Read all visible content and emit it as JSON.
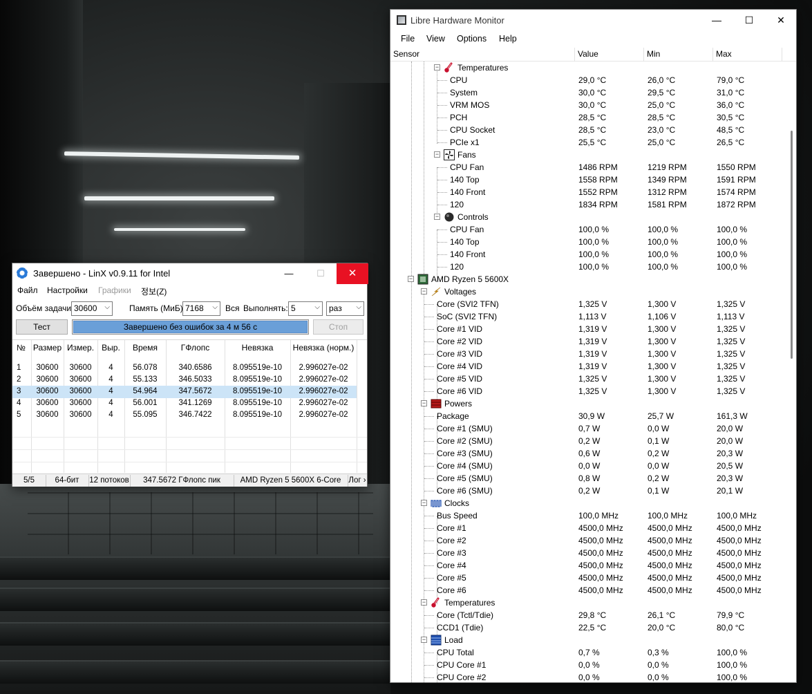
{
  "linx": {
    "title": "Завершено - LinX v0.9.11 for Intel",
    "window_controls": {
      "minimize": "—",
      "maximize": "☐",
      "close": "✕"
    },
    "menu": [
      "Файл",
      "Настройки",
      "Графики",
      "정보(Z)"
    ],
    "controls": {
      "task_size_label": "Объём задачи:",
      "task_size_value": "30600",
      "memory_label": "Память (МиБ):",
      "memory_value": "7168",
      "all_label": "Вся",
      "run_label": "Выполнять:",
      "run_value": "5",
      "unit_value": "раз"
    },
    "test_button": "Тест",
    "stop_button": "Стоп",
    "progress_text": "Завершено без ошибок за 4 м 56 с",
    "progress_value": 1.0,
    "columns": [
      "№",
      "Размер",
      "Измер.",
      "Выр.",
      "Время",
      "ГФлопс",
      "Невязка",
      "Невязка (норм.)"
    ],
    "rows": [
      [
        "1",
        "30600",
        "30600",
        "4",
        "56.078",
        "340.6586",
        "8.095519e-10",
        "2.996027e-02"
      ],
      [
        "2",
        "30600",
        "30600",
        "4",
        "55.133",
        "346.5033",
        "8.095519e-10",
        "2.996027e-02"
      ],
      [
        "3",
        "30600",
        "30600",
        "4",
        "54.964",
        "347.5672",
        "8.095519e-10",
        "2.996027e-02"
      ],
      [
        "4",
        "30600",
        "30600",
        "4",
        "56.001",
        "341.1269",
        "8.095519e-10",
        "2.996027e-02"
      ],
      [
        "5",
        "30600",
        "30600",
        "4",
        "55.095",
        "346.7422",
        "8.095519e-10",
        "2.996027e-02"
      ]
    ],
    "status": [
      "5/5",
      "64-бит",
      "12 потоков",
      "347.5672 ГФлопс пик",
      "AMD Ryzen 5 5600X 6-Core",
      "Лог ›"
    ]
  },
  "lhm": {
    "title": "Libre Hardware Monitor",
    "window_controls": {
      "minimize": "—",
      "maximize": "☐",
      "close": "✕"
    },
    "menu": [
      "File",
      "View",
      "Options",
      "Help"
    ],
    "columns": [
      "Sensor",
      "Value",
      "Min",
      "Max"
    ],
    "rows": [
      {
        "level": 2,
        "type": "group",
        "icon": "thermometer-icon",
        "label": "Temperatures"
      },
      {
        "level": 3,
        "label": "CPU",
        "value": "29,0 °C",
        "min": "26,0 °C",
        "max": "79,0 °C"
      },
      {
        "level": 3,
        "label": "System",
        "value": "30,0 °C",
        "min": "29,5 °C",
        "max": "31,0 °C"
      },
      {
        "level": 3,
        "label": "VRM MOS",
        "value": "30,0 °C",
        "min": "25,0 °C",
        "max": "36,0 °C"
      },
      {
        "level": 3,
        "label": "PCH",
        "value": "28,5 °C",
        "min": "28,5 °C",
        "max": "30,5 °C"
      },
      {
        "level": 3,
        "label": "CPU Socket",
        "value": "28,5 °C",
        "min": "23,0 °C",
        "max": "48,5 °C"
      },
      {
        "level": 3,
        "label": "PCIe x1",
        "value": "25,5 °C",
        "min": "25,0 °C",
        "max": "26,5 °C"
      },
      {
        "level": 2,
        "type": "group",
        "icon": "fan-icon",
        "label": "Fans"
      },
      {
        "level": 3,
        "label": "CPU Fan",
        "value": "1486 RPM",
        "min": "1219 RPM",
        "max": "1550 RPM"
      },
      {
        "level": 3,
        "label": "140 Top",
        "value": "1558 RPM",
        "min": "1349 RPM",
        "max": "1591 RPM"
      },
      {
        "level": 3,
        "label": "140 Front",
        "value": "1552 RPM",
        "min": "1312 RPM",
        "max": "1574 RPM"
      },
      {
        "level": 3,
        "label": "120",
        "value": "1834 RPM",
        "min": "1581 RPM",
        "max": "1872 RPM"
      },
      {
        "level": 2,
        "type": "group",
        "icon": "control-knob-icon",
        "label": "Controls"
      },
      {
        "level": 3,
        "label": "CPU Fan",
        "value": "100,0 %",
        "min": "100,0 %",
        "max": "100,0 %"
      },
      {
        "level": 3,
        "label": "140 Top",
        "value": "100,0 %",
        "min": "100,0 %",
        "max": "100,0 %"
      },
      {
        "level": 3,
        "label": "140 Front",
        "value": "100,0 %",
        "min": "100,0 %",
        "max": "100,0 %"
      },
      {
        "level": 3,
        "label": "120",
        "value": "100,0 %",
        "min": "100,0 %",
        "max": "100,0 %"
      },
      {
        "level": 0,
        "type": "group",
        "icon": "cpu-chip-icon",
        "label": "AMD Ryzen 5 5600X"
      },
      {
        "level": 1,
        "type": "group",
        "icon": "lightning-icon",
        "label": "Voltages"
      },
      {
        "level": 2,
        "label": "Core (SVI2 TFN)",
        "value": "1,325 V",
        "min": "1,300 V",
        "max": "1,325 V"
      },
      {
        "level": 2,
        "label": "SoC (SVI2 TFN)",
        "value": "1,113 V",
        "min": "1,106 V",
        "max": "1,113 V"
      },
      {
        "level": 2,
        "label": "Core #1 VID",
        "value": "1,319 V",
        "min": "1,300 V",
        "max": "1,325 V"
      },
      {
        "level": 2,
        "label": "Core #2 VID",
        "value": "1,319 V",
        "min": "1,300 V",
        "max": "1,325 V"
      },
      {
        "level": 2,
        "label": "Core #3 VID",
        "value": "1,319 V",
        "min": "1,300 V",
        "max": "1,325 V"
      },
      {
        "level": 2,
        "label": "Core #4 VID",
        "value": "1,319 V",
        "min": "1,300 V",
        "max": "1,325 V"
      },
      {
        "level": 2,
        "label": "Core #5 VID",
        "value": "1,325 V",
        "min": "1,300 V",
        "max": "1,325 V"
      },
      {
        "level": 2,
        "label": "Core #6 VID",
        "value": "1,325 V",
        "min": "1,300 V",
        "max": "1,325 V"
      },
      {
        "level": 1,
        "type": "group",
        "icon": "power-icon",
        "label": "Powers"
      },
      {
        "level": 2,
        "label": "Package",
        "value": "30,9 W",
        "min": "25,7 W",
        "max": "161,3 W"
      },
      {
        "level": 2,
        "label": "Core #1 (SMU)",
        "value": "0,7 W",
        "min": "0,0 W",
        "max": "20,0 W"
      },
      {
        "level": 2,
        "label": "Core #2 (SMU)",
        "value": "0,2 W",
        "min": "0,1 W",
        "max": "20,0 W"
      },
      {
        "level": 2,
        "label": "Core #3 (SMU)",
        "value": "0,6 W",
        "min": "0,2 W",
        "max": "20,3 W"
      },
      {
        "level": 2,
        "label": "Core #4 (SMU)",
        "value": "0,0 W",
        "min": "0,0 W",
        "max": "20,5 W"
      },
      {
        "level": 2,
        "label": "Core #5 (SMU)",
        "value": "0,8 W",
        "min": "0,2 W",
        "max": "20,3 W"
      },
      {
        "level": 2,
        "label": "Core #6 (SMU)",
        "value": "0,2 W",
        "min": "0,1 W",
        "max": "20,1 W"
      },
      {
        "level": 1,
        "type": "group",
        "icon": "clock-signal-icon",
        "label": "Clocks"
      },
      {
        "level": 2,
        "label": "Bus Speed",
        "value": "100,0 MHz",
        "min": "100,0 MHz",
        "max": "100,0 MHz"
      },
      {
        "level": 2,
        "label": "Core #1",
        "value": "4500,0 MHz",
        "min": "4500,0 MHz",
        "max": "4500,0 MHz"
      },
      {
        "level": 2,
        "label": "Core #2",
        "value": "4500,0 MHz",
        "min": "4500,0 MHz",
        "max": "4500,0 MHz"
      },
      {
        "level": 2,
        "label": "Core #3",
        "value": "4500,0 MHz",
        "min": "4500,0 MHz",
        "max": "4500,0 MHz"
      },
      {
        "level": 2,
        "label": "Core #4",
        "value": "4500,0 MHz",
        "min": "4500,0 MHz",
        "max": "4500,0 MHz"
      },
      {
        "level": 2,
        "label": "Core #5",
        "value": "4500,0 MHz",
        "min": "4500,0 MHz",
        "max": "4500,0 MHz"
      },
      {
        "level": 2,
        "label": "Core #6",
        "value": "4500,0 MHz",
        "min": "4500,0 MHz",
        "max": "4500,0 MHz"
      },
      {
        "level": 1,
        "type": "group",
        "icon": "thermometer-icon",
        "label": "Temperatures"
      },
      {
        "level": 2,
        "label": "Core (Tctl/Tdie)",
        "value": "29,8 °C",
        "min": "26,1 °C",
        "max": "79,9 °C"
      },
      {
        "level": 2,
        "label": "CCD1 (Tdie)",
        "value": "22,5 °C",
        "min": "20,0 °C",
        "max": "80,0 °C"
      },
      {
        "level": 1,
        "type": "group",
        "icon": "load-icon",
        "label": "Load"
      },
      {
        "level": 2,
        "label": "CPU Total",
        "value": "0,7 %",
        "min": "0,3 %",
        "max": "100,0 %"
      },
      {
        "level": 2,
        "label": "CPU Core #1",
        "value": "0,0 %",
        "min": "0,0 %",
        "max": "100,0 %"
      },
      {
        "level": 2,
        "label": "CPU Core #2",
        "value": "0,0 %",
        "min": "0,0 %",
        "max": "100,0 %"
      }
    ]
  }
}
